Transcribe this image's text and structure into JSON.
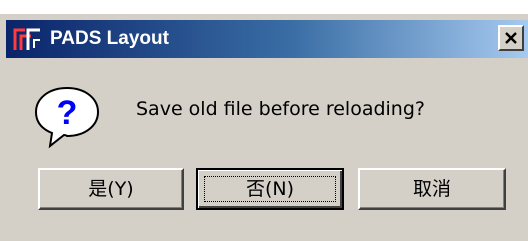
{
  "window": {
    "title": "PADS Layout",
    "app_icon": "pads-logo-icon",
    "close_icon": "close-icon",
    "close_glyph": "✕"
  },
  "dialog": {
    "icon": "question-icon",
    "message": "Save old file before reloading?"
  },
  "buttons": {
    "yes": "是(Y)",
    "no": "否(N)",
    "cancel": "取消",
    "default": "no"
  },
  "colors": {
    "title_gradient_start": "#0a246a",
    "title_gradient_end": "#a6caf0",
    "dialog_face": "#d4d0c8",
    "icon_bubble": "#ffffff",
    "icon_mark": "#0000ff"
  }
}
